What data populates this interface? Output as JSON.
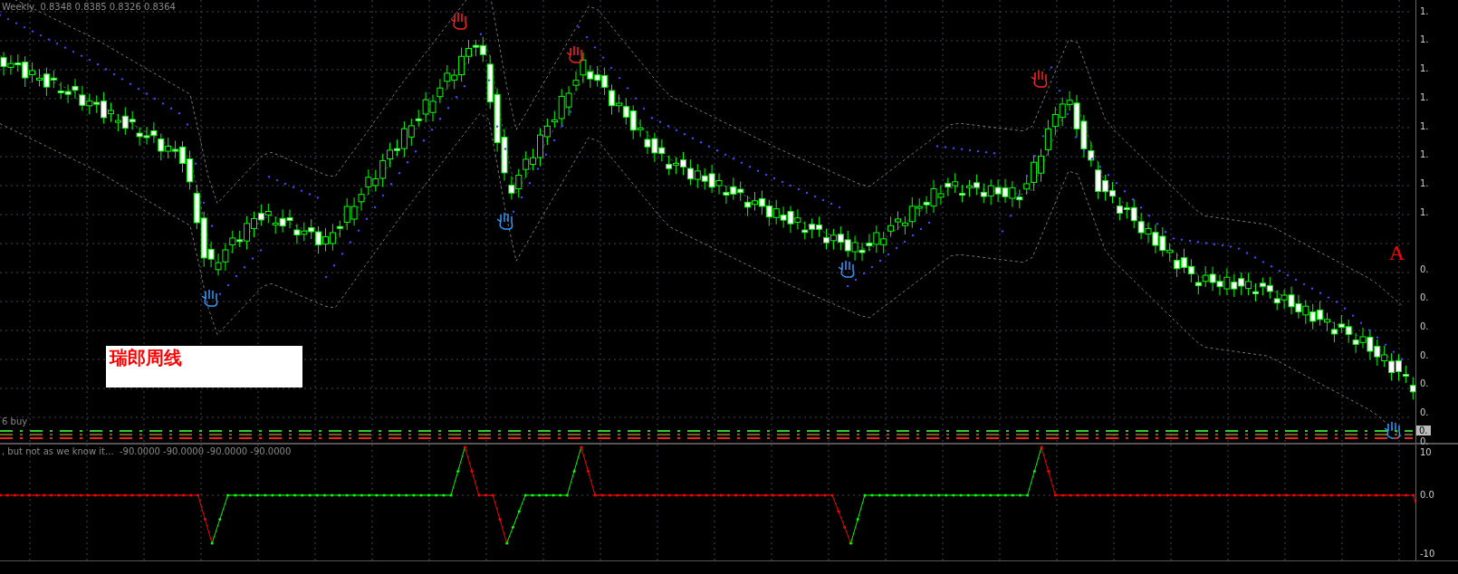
{
  "header": {
    "title": "Weekly",
    "ohlc": [
      "0.8348",
      "0.8385",
      "0.8326",
      "0.8364"
    ]
  },
  "annotation": {
    "text": "瑞郎周线"
  },
  "marker": {
    "text": "A"
  },
  "main_axis": {
    "labels": [
      "1.",
      "1.",
      "1.",
      "1.",
      "1.",
      "1.",
      "1.",
      "1.",
      "0.",
      "0.",
      "0.",
      "0.",
      "0.",
      "0.",
      "0."
    ],
    "current_price": "0."
  },
  "signal_legend": {
    "text": "6 buy"
  },
  "indicator": {
    "legend": ", but not as we know it...",
    "values": [
      "-90.0000",
      "-90.0000",
      "-90.0000",
      "-90.0000"
    ],
    "axis_labels": [
      "10",
      "0.0",
      "-10"
    ]
  }
}
